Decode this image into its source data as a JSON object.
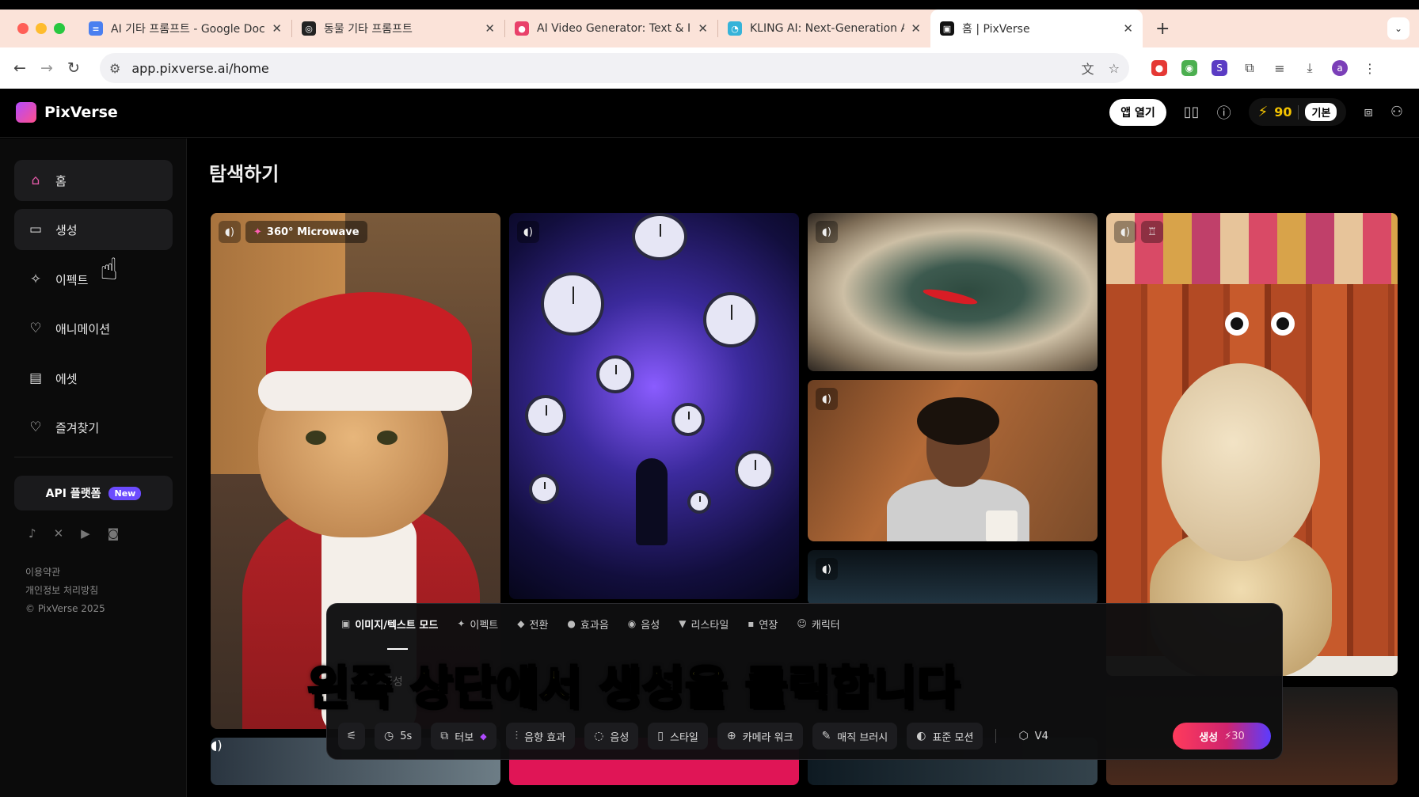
{
  "browser": {
    "tabs": [
      {
        "title": "AI 기타 프롬프트 - Google Docs",
        "favicon_color": "#4a7ff0",
        "active": false
      },
      {
        "title": "동물 기타 프롬프트",
        "favicon_color": "#222222",
        "active": false
      },
      {
        "title": "AI Video Generator: Text & Im",
        "favicon_color": "#e9416a",
        "active": false
      },
      {
        "title": "KLING AI: Next-Generation AI",
        "favicon_color": "#36b3d9",
        "active": false
      },
      {
        "title": "홈 | PixVerse",
        "favicon_color": "#111111",
        "active": true
      }
    ],
    "new_tab_symbol": "+",
    "url": "app.pixverse.ai/home",
    "profile_initial": "a"
  },
  "header": {
    "brand": "PixVerse",
    "open_app_label": "앱 열기",
    "credits": "90",
    "plan": "기본"
  },
  "sidebar": {
    "items": [
      {
        "label": "홈",
        "icon": "home-icon",
        "active": true
      },
      {
        "label": "생성",
        "icon": "video-icon",
        "active": true
      },
      {
        "label": "이펙트",
        "icon": "sparkle-icon",
        "active": false
      },
      {
        "label": "애니메이션",
        "icon": "heart-face-icon",
        "active": false
      },
      {
        "label": "에셋",
        "icon": "folder-icon",
        "active": false
      },
      {
        "label": "즐겨찾기",
        "icon": "heart-icon",
        "active": false
      }
    ],
    "api_label": "API 플랫폼",
    "api_badge": "New",
    "socials": [
      "tiktok-icon",
      "x-icon",
      "youtube-icon",
      "discord-icon"
    ],
    "legal": {
      "terms": "이용약관",
      "privacy": "개인정보 처리방침",
      "copyright": "© PixVerse 2025"
    }
  },
  "main": {
    "title": "탐색하기",
    "feature_tag": "360° Microwave"
  },
  "panel": {
    "mode_tabs": [
      {
        "label": "이미지/텍스트 모드",
        "icon": "image-icon",
        "active": true
      },
      {
        "label": "이펙트",
        "icon": "sparkle-icon",
        "active": false
      },
      {
        "label": "전환",
        "icon": "transition-icon",
        "active": false
      },
      {
        "label": "효과음",
        "icon": "sound-effect-icon",
        "active": false
      },
      {
        "label": "음성",
        "icon": "voice-icon",
        "active": false
      },
      {
        "label": "리스타일",
        "icon": "restyle-icon",
        "active": false
      },
      {
        "label": "연장",
        "icon": "extend-icon",
        "active": false
      },
      {
        "label": "캐릭터",
        "icon": "character-icon",
        "active": false
      }
    ],
    "prompt_hint": "생성",
    "tools": {
      "duration": "5s",
      "turbo": "터보",
      "sound": "음향 효과",
      "voice": "음성",
      "style": "스타일",
      "camera": "카메라 워크",
      "magic_brush": "매직 브러시",
      "motion": "표준 모션",
      "model": "V4"
    },
    "generate_label": "생성",
    "generate_cost": "⚡30"
  },
  "subtitle": "왼쪽 상단에서 생성을 클릭합니다"
}
